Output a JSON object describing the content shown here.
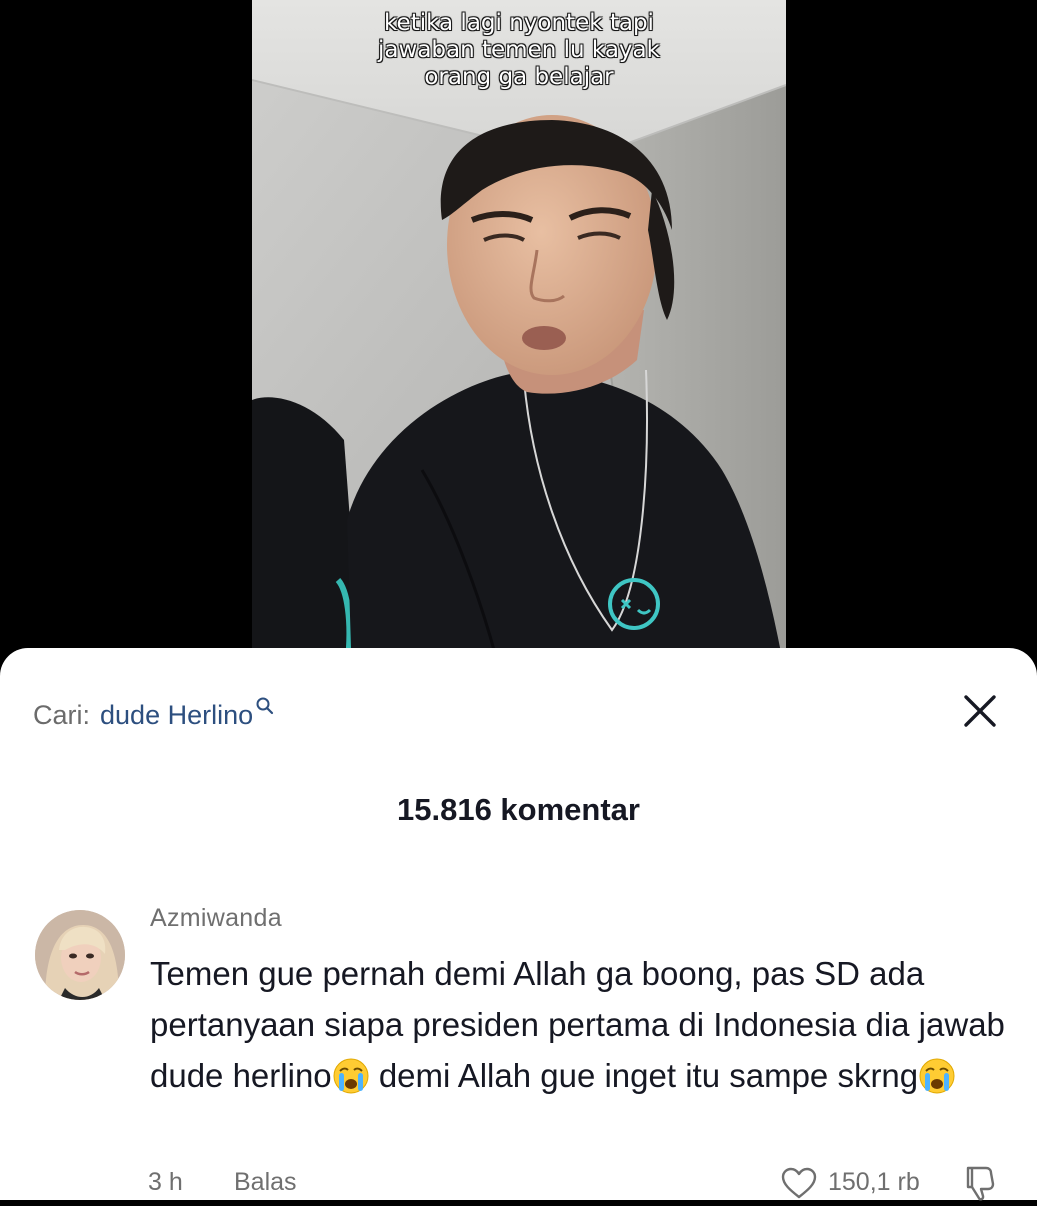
{
  "video": {
    "caption_lines": [
      "ketika lagi nyontek tapi",
      "jawaban temen lu kayak",
      "orang ga belajar"
    ]
  },
  "search": {
    "label": "Cari:",
    "query": "dude Herlino"
  },
  "comments_header": {
    "count_text": "15.816 komentar"
  },
  "comment": {
    "username": "Azmiwanda",
    "text_part1": "Temen gue pernah demi Allah ga boong, pas SD ada pertanyaan siapa presiden pertama di Indonesia dia jawab dude herlino",
    "text_part2": " demi Allah gue inget itu sampe skrng",
    "emoji": "loudly-crying-face",
    "time": "3 h",
    "reply_label": "Balas",
    "likes": "150,1 rb"
  },
  "colors": {
    "search_query": "#2d4f7f",
    "text_primary": "#161823",
    "text_secondary": "#6f6f6f",
    "accent_teal": "#3fc6c4"
  }
}
